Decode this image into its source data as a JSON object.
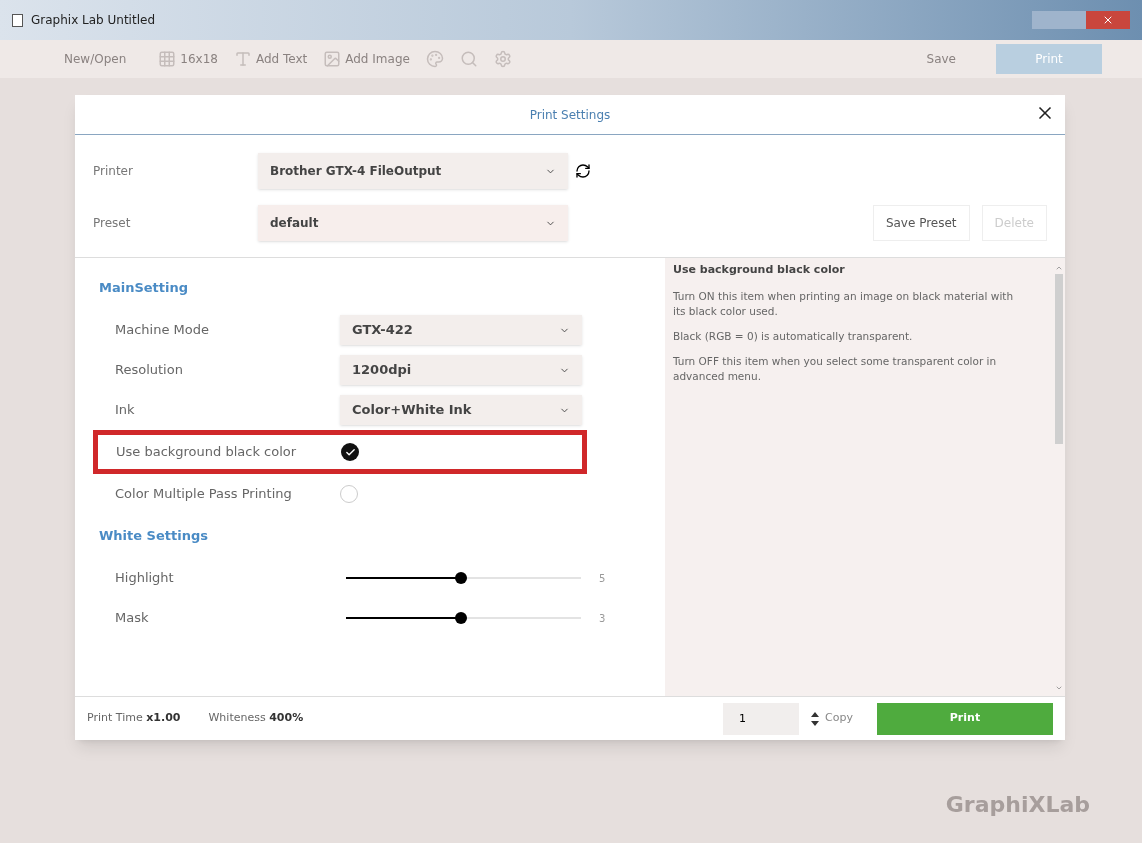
{
  "window": {
    "title": "Graphix Lab Untitled"
  },
  "toolbar": [
    {
      "label": "New/Open",
      "kind": "text"
    },
    {
      "label": "16x18",
      "kind": "grid"
    },
    {
      "label": "Add Text",
      "kind": "addtext"
    },
    {
      "label": "Add Image",
      "kind": "addimage"
    },
    {
      "kind": "palette"
    },
    {
      "kind": "search"
    },
    {
      "kind": "settings"
    },
    {
      "label": "Save",
      "kind": "text"
    },
    {
      "label": "Print",
      "kind": "primary"
    }
  ],
  "dialog": {
    "title": "Print Settings",
    "printer": {
      "label": "Printer",
      "value": "Brother GTX-4 FileOutput"
    },
    "preset": {
      "label": "Preset",
      "value": "default"
    },
    "buttons": [
      {
        "label": "Save Preset",
        "disabled": false
      },
      {
        "label": "Delete",
        "disabled": true
      }
    ],
    "sections": [
      {
        "title": "MainSetting",
        "rows": [
          {
            "kind": "select",
            "label": "Machine Mode",
            "value": "GTX-422",
            "highlighted": false
          },
          {
            "kind": "select",
            "label": "Resolution",
            "value": "1200dpi",
            "highlighted": false
          },
          {
            "kind": "select",
            "label": "Ink",
            "value": "Color+White Ink",
            "highlighted": false
          },
          {
            "kind": "check",
            "label": "Use background black color",
            "checked": true,
            "highlighted": true
          },
          {
            "kind": "check",
            "label": "Color Multiple Pass Printing",
            "checked": false,
            "highlighted": false
          }
        ]
      },
      {
        "title": "White Settings",
        "rows": [
          {
            "kind": "slider",
            "label": "Highlight",
            "level": 0.49,
            "reading": "5",
            "highlighted": false
          },
          {
            "kind": "slider",
            "label": "Mask",
            "level": 0.49,
            "reading": "3",
            "highlighted": false
          }
        ]
      }
    ],
    "help": {
      "title": "Use background black color",
      "paragraphs": [
        "Turn ON this item when printing an image on black material with its black color used.",
        "Black (RGB = 0) is automatically transparent.",
        "Turn OFF this item when you select some transparent color in advanced menu."
      ]
    },
    "footer": {
      "print_time_label": "Print Time",
      "print_time": "x1.00",
      "whiteness_label": "Whiteness",
      "whiteness": "400%",
      "copies": "1",
      "copy_label": "Copy",
      "print_button": "Print"
    }
  },
  "logo": "GraphiXLab"
}
